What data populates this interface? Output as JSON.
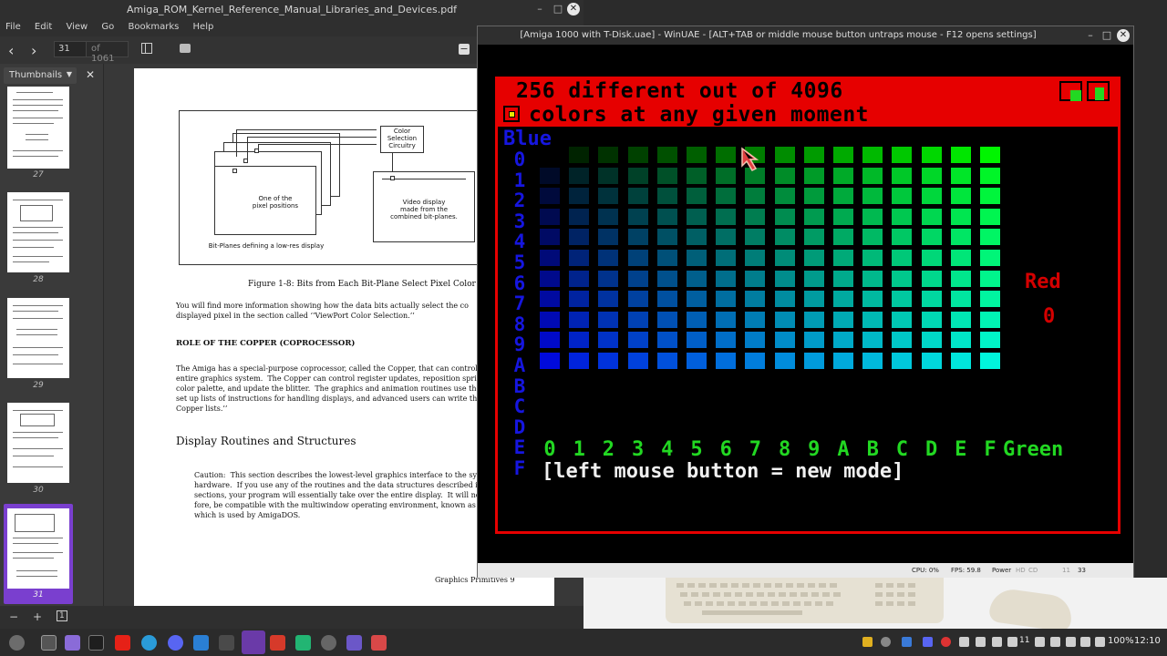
{
  "pdf": {
    "title": "Amiga_ROM_Kernel_Reference_Manual_Libraries_and_Devices.pdf",
    "menu": [
      "File",
      "Edit",
      "View",
      "Go",
      "Bookmarks",
      "Help"
    ],
    "page_current": "31",
    "page_total": "of 1061",
    "thumbnails_label": "Thumbnails",
    "thumb_pages": [
      "27",
      "28",
      "29",
      "30",
      "31"
    ],
    "figure": {
      "color_selection": "Color\nSelection\nCircuitry",
      "pixel_positions": "One of the\npixel positions",
      "video_display": "Video display\nmade from the\ncombined bit-planes.",
      "bitplanes_label": "Bit-Planes defining a low-res display",
      "caption": "Figure 1-8: Bits from Each Bit-Plane Select Pixel Color"
    },
    "para1": "You will find more information showing how the data bits actually select the co\ndisplayed pixel in the section called ‘‘ViewPort Color Selection.’’",
    "heading_copper": "ROLE OF THE COPPER (COPROCESSOR)",
    "para2": "The Amiga has a special-purpose coprocessor, called the Copper, that can control m\nentire graphics system.  The Copper can control register updates, reposition sprites, c\ncolor palette, and update the blitter.  The graphics and animation routines use the\nset up lists of instructions for handling displays, and advanced users can write their o\nCopper lists.’’",
    "section_title": "Display Routines and Structures",
    "caution": "Caution:  This section describes the lowest-level graphics interface to the sy\nhardware.  If you use any of the routines and the data structures described in\nsections, your program will essentially take over the entire display.  It will not, t\nfore, be compatible with the multiwindow operating environment, known as Intu\nwhich is used by AmigaDOS.",
    "footer": "Graphics Primitives  9"
  },
  "uae": {
    "title": "[Amiga 1000 with T-Disk.uae] - WinUAE - [ALT+TAB or middle mouse button untraps mouse - F12 opens settings]",
    "status": {
      "cpu": "CPU: 0%",
      "fps": "FPS: 59.8",
      "power": "Power",
      "hd": "HD",
      "cd": "CD",
      "drive1": "11",
      "drive2": "33"
    },
    "screen": {
      "header1": "256 different out of 4096",
      "header2": "colors at any given moment",
      "blue_label": "Blue",
      "row_labels": [
        "0",
        "1",
        "2",
        "3",
        "4",
        "5",
        "6",
        "7",
        "8",
        "9",
        "A",
        "B",
        "C",
        "D",
        "E",
        "F"
      ],
      "col_labels": [
        "0",
        "1",
        "2",
        "3",
        "4",
        "5",
        "6",
        "7",
        "8",
        "9",
        "A",
        "B",
        "C",
        "D",
        "E",
        "F"
      ],
      "green_label": "Green",
      "red_label": "Red",
      "red_value": "0",
      "footer": "[left mouse button = new mode]"
    }
  },
  "taskbar": {
    "tray_number": "11",
    "battery": "100%",
    "clock": "12:10"
  }
}
